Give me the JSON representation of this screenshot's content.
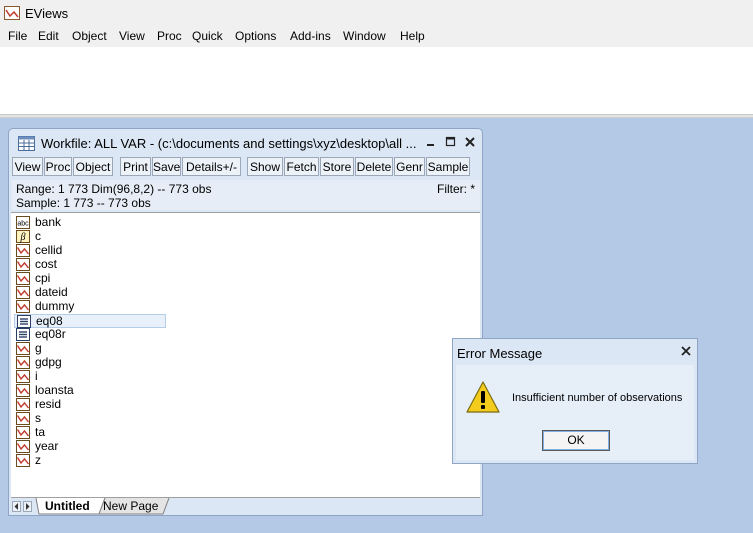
{
  "app": {
    "title": "EViews"
  },
  "menu": [
    "File",
    "Edit",
    "Object",
    "View",
    "Proc",
    "Quick",
    "Options",
    "Add-ins",
    "Window",
    "Help"
  ],
  "workfile": {
    "title": "Workfile: ALL VAR - (c:\\documents and settings\\xyz\\desktop\\all ...",
    "toolbar": [
      "View",
      "Proc",
      "Object",
      "Print",
      "Save",
      "Details+/-",
      "Show",
      "Fetch",
      "Store",
      "Delete",
      "Genr",
      "Sample"
    ],
    "range_text": "Range:  1 773   Dim(96,8,2)  --   773 obs",
    "filter_text": "Filter: *",
    "sample_text": "Sample: 1 773   --   773 obs",
    "objects": [
      {
        "name": "bank",
        "type": "alpha"
      },
      {
        "name": "c",
        "type": "coef"
      },
      {
        "name": "cellid",
        "type": "series"
      },
      {
        "name": "cost",
        "type": "series"
      },
      {
        "name": "cpi",
        "type": "series"
      },
      {
        "name": "dateid",
        "type": "series"
      },
      {
        "name": "dummy",
        "type": "series"
      },
      {
        "name": "eq08",
        "type": "equation",
        "selected": true
      },
      {
        "name": "eq08r",
        "type": "equation"
      },
      {
        "name": "g",
        "type": "series"
      },
      {
        "name": "gdpg",
        "type": "series"
      },
      {
        "name": "i",
        "type": "series"
      },
      {
        "name": "loansta",
        "type": "series"
      },
      {
        "name": "resid",
        "type": "series"
      },
      {
        "name": "s",
        "type": "series"
      },
      {
        "name": "ta",
        "type": "series"
      },
      {
        "name": "year",
        "type": "series"
      },
      {
        "name": "z",
        "type": "series"
      }
    ],
    "tabs": [
      "Untitled",
      "New Page"
    ],
    "active_tab": "Untitled",
    "icon_glyphs": {
      "alpha": "abc",
      "coef": "β"
    }
  },
  "dialog": {
    "title": "Error Message",
    "message": "Insufficient number of observations",
    "ok_label": "OK",
    "close_glyph": "✕"
  },
  "colors": {
    "desktop": "#b4c9e6",
    "window": "#dce7f5",
    "selection": "#e8f1fb",
    "icon_accent": "#c0392b"
  }
}
